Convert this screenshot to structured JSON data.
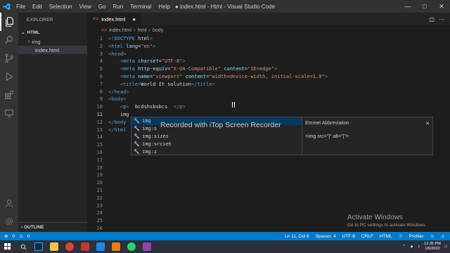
{
  "titlebar": {
    "menu": [
      "File",
      "Edit",
      "Selection",
      "View",
      "Go",
      "Run",
      "Terminal",
      "Help"
    ],
    "title": "● index.html - Html - Visual Studio Code"
  },
  "sidebar": {
    "header": "EXPLORER",
    "section": "HTML",
    "items": [
      "img",
      "index.html"
    ],
    "outline": "OUTLINE"
  },
  "editor": {
    "tab_label": "index.html",
    "breadcrumb": [
      "index.html",
      "html",
      "body"
    ]
  },
  "code_lines": [
    {
      "n": "1",
      "segments": [
        [
          "br",
          "<!"
        ],
        [
          "tag",
          "DOCTYPE"
        ],
        [
          "attr",
          " html"
        ],
        [
          "br",
          ">"
        ]
      ]
    },
    {
      "n": "2",
      "segments": [
        [
          "br",
          "<"
        ],
        [
          "tag",
          "html"
        ],
        [
          "attr",
          " lang"
        ],
        [
          "txt",
          "="
        ],
        [
          "val",
          "\"en\""
        ],
        [
          "br",
          ">"
        ]
      ]
    },
    {
      "n": "3",
      "segments": [
        [
          "br",
          "<"
        ],
        [
          "tag",
          "head"
        ],
        [
          "br",
          ">"
        ]
      ]
    },
    {
      "n": "4",
      "segments": [
        [
          "txt",
          "    "
        ],
        [
          "br",
          "<"
        ],
        [
          "tag",
          "meta"
        ],
        [
          "attr",
          " charset"
        ],
        [
          "txt",
          "="
        ],
        [
          "val",
          "\"UTF-8\""
        ],
        [
          "br",
          ">"
        ]
      ]
    },
    {
      "n": "5",
      "segments": [
        [
          "txt",
          "    "
        ],
        [
          "br",
          "<"
        ],
        [
          "tag",
          "meta"
        ],
        [
          "attr",
          " http-equiv"
        ],
        [
          "txt",
          "="
        ],
        [
          "val",
          "\"X-UA-Compatible\""
        ],
        [
          "attr",
          " content"
        ],
        [
          "txt",
          "="
        ],
        [
          "val",
          "\"IE=edge\""
        ],
        [
          "br",
          ">"
        ]
      ]
    },
    {
      "n": "6",
      "segments": [
        [
          "txt",
          "    "
        ],
        [
          "br",
          "<"
        ],
        [
          "tag",
          "meta"
        ],
        [
          "attr",
          " name"
        ],
        [
          "txt",
          "="
        ],
        [
          "val",
          "\"viewport\""
        ],
        [
          "attr",
          " content"
        ],
        [
          "txt",
          "="
        ],
        [
          "val",
          "\"width=device-width, initial-scale=1.0\""
        ],
        [
          "br",
          ">"
        ]
      ]
    },
    {
      "n": "7",
      "segments": [
        [
          "txt",
          "    "
        ],
        [
          "br",
          "<"
        ],
        [
          "tag",
          "title"
        ],
        [
          "br",
          ">"
        ],
        [
          "txt",
          "World It solution"
        ],
        [
          "br",
          "</"
        ],
        [
          "tag",
          "title"
        ],
        [
          "br",
          ">"
        ]
      ]
    },
    {
      "n": "8",
      "segments": [
        [
          "br",
          "</"
        ],
        [
          "tag",
          "head"
        ],
        [
          "br",
          ">"
        ]
      ]
    },
    {
      "n": "9",
      "segments": [
        [
          "br",
          "<"
        ],
        [
          "tag",
          "body"
        ],
        [
          "br",
          ">"
        ]
      ]
    },
    {
      "n": "10",
      "segments": [
        [
          "txt",
          "    "
        ],
        [
          "br",
          "<"
        ],
        [
          "tag",
          "p"
        ],
        [
          "br",
          ">"
        ],
        [
          "txt",
          "  bcdshsbsbcs  "
        ],
        [
          "br",
          "</"
        ],
        [
          "tag",
          "p"
        ],
        [
          "br",
          ">"
        ]
      ]
    },
    {
      "n": "11",
      "segments": [
        [
          "txt",
          "    img"
        ]
      ]
    },
    {
      "n": "12",
      "segments": [
        [
          "br",
          "</"
        ],
        [
          "tag",
          "body"
        ]
      ]
    },
    {
      "n": "13",
      "segments": [
        [
          "br",
          "</"
        ],
        [
          "tag",
          "html"
        ]
      ]
    },
    {
      "n": "14",
      "segments": []
    },
    {
      "n": "15",
      "segments": []
    },
    {
      "n": "16",
      "segments": []
    },
    {
      "n": "17",
      "segments": []
    },
    {
      "n": "18",
      "segments": []
    },
    {
      "n": "19",
      "segments": []
    },
    {
      "n": "20",
      "segments": []
    },
    {
      "n": "21",
      "segments": []
    },
    {
      "n": "22",
      "segments": []
    },
    {
      "n": "23",
      "segments": []
    },
    {
      "n": "24",
      "segments": []
    },
    {
      "n": "25",
      "segments": []
    },
    {
      "n": "26",
      "segments": []
    }
  ],
  "suggestions": {
    "items": [
      "img",
      "img:s",
      "img:sizes",
      "img:srcset",
      "img:z"
    ],
    "detail_title": "Emmet Abbreviation",
    "detail_body": "<img src=\"|\" alt=\"|\">"
  },
  "overlay": {
    "watermark": "Recorded with iTop Screen Recorder",
    "activate_title": "Activate Windows",
    "activate_sub": "Go to PC settings to activate Windows."
  },
  "statusbar": {
    "errors": "0",
    "warnings": "0",
    "position": "Ln 11, Col 8",
    "spaces": "Spaces: 4",
    "encoding": "UTF-8",
    "eol": "CRLF",
    "language": "HTML",
    "prettier": "Prettier"
  },
  "taskbar": {
    "time": "12:35 PM",
    "date": "1/6/2022"
  }
}
